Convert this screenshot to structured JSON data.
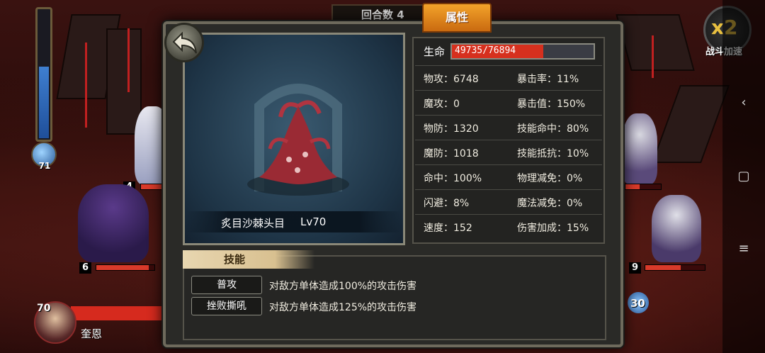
{
  "battle": {
    "round_label": "回合数 4",
    "mana_value": "71",
    "speed": {
      "multiplier": "x2",
      "label": "战斗加速"
    },
    "left_units": [
      {
        "level": "4",
        "hp_fraction": 0.85
      },
      {
        "level": "6",
        "hp_fraction": 0.9
      }
    ],
    "right_units": [
      {
        "level": "9",
        "hp_fraction": 0.6
      }
    ],
    "right_mana": "30",
    "hero": {
      "level": "70",
      "name": "奎恩"
    }
  },
  "panel": {
    "active_tab": "属性",
    "monster": {
      "name": "炙目沙棘头目",
      "level": "Lv70"
    },
    "hp": {
      "label": "生命",
      "value": "49735/76894",
      "fraction": 0.647
    },
    "stats": [
      [
        "物攻：6748",
        "暴击率：11%"
      ],
      [
        "魔攻：0",
        "暴击值：150%"
      ],
      [
        "物防：1320",
        "技能命中：80%"
      ],
      [
        "魔防：1018",
        "技能抵抗：10%"
      ],
      [
        "命中：100%",
        "物理减免：0%"
      ],
      [
        "闪避：8%",
        "魔法减免：0%"
      ],
      [
        "速度：152",
        "伤害加成：15%"
      ]
    ],
    "skills_header": "技能",
    "skills": [
      {
        "name": "普攻",
        "desc": "对敌方单体造成100%的攻击伤害"
      },
      {
        "name": "挫败撕吼",
        "desc": "对敌方单体造成125%的攻击伤害"
      }
    ]
  },
  "colors": {
    "accent_tab": "#e8901e",
    "hp": "#d6301e",
    "panel_bg": "#2a2a27"
  },
  "icons": {
    "back": "back-arrow-icon",
    "android_back": "chevron-left-icon",
    "android_home": "square-icon",
    "android_menu": "menu-icon"
  }
}
